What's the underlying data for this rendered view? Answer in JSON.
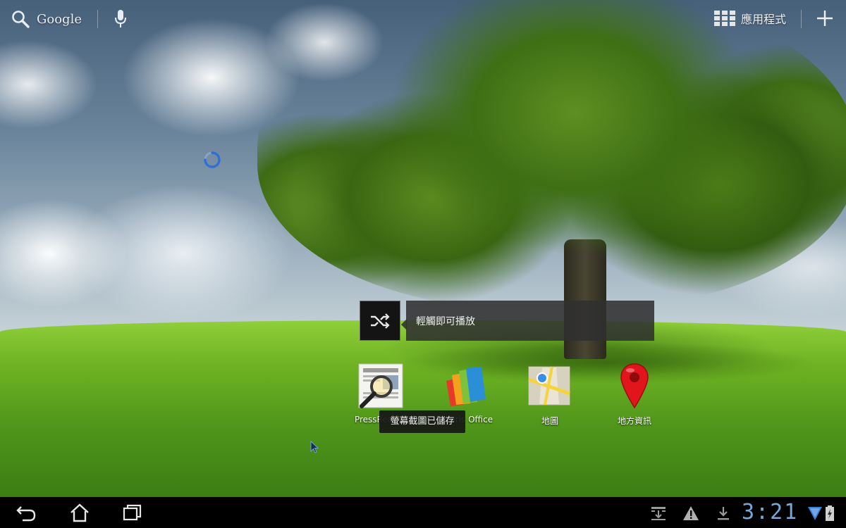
{
  "top_bar": {
    "search_label": "Google",
    "apps_label": "應用程式"
  },
  "music_widget": {
    "hint": "輕觸即可播放"
  },
  "apps": [
    {
      "label": "PressReader",
      "icon": "pressreader-icon"
    },
    {
      "label": "Polaris Office",
      "icon": "polaris-office-icon"
    },
    {
      "label": "地圖",
      "icon": "maps-icon"
    },
    {
      "label": "地方資訊",
      "icon": "places-icon"
    }
  ],
  "toast": {
    "message": "螢幕截圖已儲存"
  },
  "system_bar": {
    "clock": "3:21"
  },
  "colors": {
    "clock": "#7aa8d6",
    "panel": "#303030",
    "accent_red": "#e0161c"
  }
}
